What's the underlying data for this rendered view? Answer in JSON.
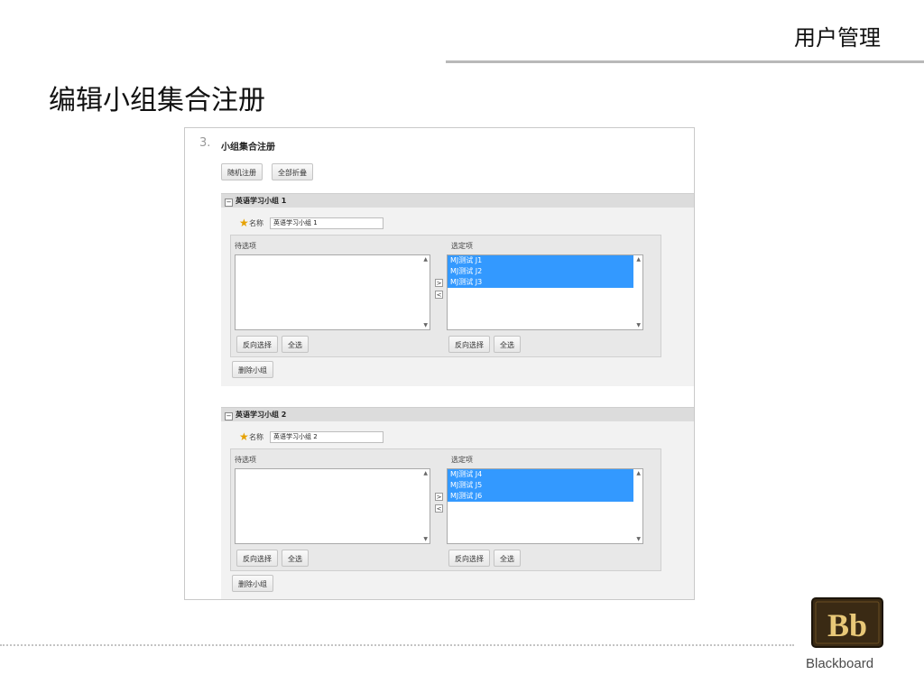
{
  "slide": {
    "header": "用户管理",
    "title": "编辑小组集合注册",
    "brand": "Blackboard"
  },
  "step": {
    "number": "3.",
    "title": "小组集合注册",
    "random_btn": "随机注册",
    "collapse_btn": "全部折叠"
  },
  "groups": [
    {
      "name": "英语学习小组 1",
      "name_label": "名称",
      "name_value": "英语学习小组 1",
      "available_label": "待选项",
      "selected_label": "选定项",
      "selected_items": [
        "MJ测试 J1",
        "MJ测试 J2",
        "MJ测试 J3"
      ],
      "invert_btn": "反向选择",
      "select_all_btn": "全选",
      "delete_btn": "删除小组"
    },
    {
      "name": "英语学习小组 2",
      "name_label": "名称",
      "name_value": "英语学习小组 2",
      "available_label": "待选项",
      "selected_label": "选定项",
      "selected_items": [
        "MJ测试 J4",
        "MJ测试 J5",
        "MJ测试 J6"
      ],
      "invert_btn": "反向选择",
      "select_all_btn": "全选",
      "delete_btn": "删除小组"
    }
  ],
  "icons": {
    "toggle": "−",
    "move_right": ">",
    "move_left": "<",
    "scroll_up": "▲",
    "scroll_down": "▼",
    "required": "★"
  },
  "colors": {
    "selection": "#3399ff",
    "required_star": "#e6a100",
    "logo_bg": "#3a2a14",
    "logo_text": "#e8c878"
  }
}
